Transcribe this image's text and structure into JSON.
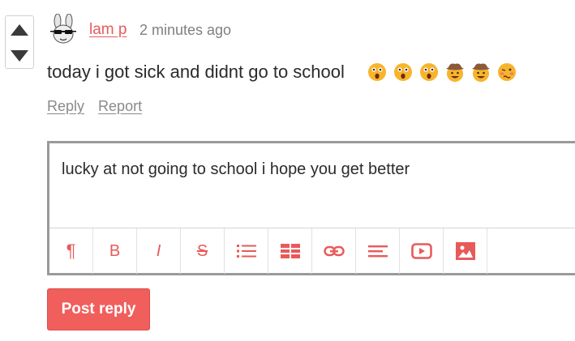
{
  "comment": {
    "author": "lam p",
    "time": "2 minutes ago",
    "text": "today i got sick and didnt go to school",
    "emojis": [
      "astonished-face",
      "astonished-face",
      "astonished-face",
      "cowboy-face",
      "cowboy-face",
      "woozy-face"
    ],
    "actions": {
      "reply": "Reply",
      "report": "Report"
    }
  },
  "reply_editor": {
    "value": "lucky at not going to school i hope you get better",
    "toolbar": [
      "paragraph-icon",
      "bold-icon",
      "italic-icon",
      "strikethrough-icon",
      "bulleted-list-icon",
      "table-icon",
      "link-icon",
      "align-left-icon",
      "video-icon",
      "image-icon"
    ],
    "toolbar_glyphs": {
      "paragraph": "¶",
      "bold": "B",
      "italic": "I",
      "strike": "S"
    }
  },
  "post_button": {
    "label": "Post reply"
  },
  "colors": {
    "accent": "#e85a5a",
    "button": "#f05f5c",
    "muted": "#808080",
    "text": "#2b2b2b"
  }
}
